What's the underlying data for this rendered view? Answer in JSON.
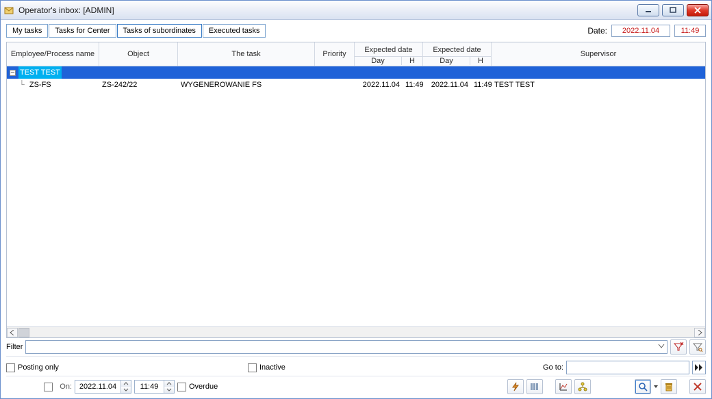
{
  "window": {
    "title": "Operator's inbox: [ADMIN]"
  },
  "tabs": [
    {
      "label": "My tasks"
    },
    {
      "label": "Tasks for Center"
    },
    {
      "label": "Tasks of subordinates",
      "active": true
    },
    {
      "label": "Executed tasks"
    }
  ],
  "date_label": "Date:",
  "date_value": "2022.11.04",
  "time_value": "11:49",
  "columns": {
    "employee": "Employee/Process name",
    "object": "Object",
    "task": "The task",
    "priority": "Priority",
    "expected1": "Expected date",
    "expected2": "Expected date",
    "sub_day": "Day",
    "sub_h": "H",
    "supervisor": "Supervisor"
  },
  "rows": {
    "group": {
      "employee": "TEST TEST"
    },
    "item": {
      "employee": "ZS-FS",
      "object": "ZS-242/22",
      "task": "WYGENEROWANIE FS",
      "priority": "",
      "exp1_day": "2022.11.04",
      "exp1_h": "11:49",
      "exp2_day": "2022.11.04",
      "exp2_h": "11:49",
      "supervisor": "TEST TEST"
    }
  },
  "filter": {
    "label": "Filter",
    "value": ""
  },
  "options": {
    "posting_only": "Posting only",
    "inactive": "Inactive",
    "goto_label": "Go to:"
  },
  "bottom": {
    "on_label": "On:",
    "date": "2022.11.04",
    "time": "11:49",
    "overdue": "Overdue"
  },
  "icons": {
    "app": "inbox-icon",
    "min": "minimize-icon",
    "max": "maximize-icon",
    "close": "close-icon",
    "clear_filter": "clear-filter-icon",
    "filter_builder": "filter-builder-icon",
    "goto": "fast-forward-icon",
    "toolbar1": "bolt-icon",
    "toolbar2": "columns-icon",
    "toolbar3": "chart-icon",
    "toolbar4": "hierarchy-icon",
    "zoom": "magnifier-icon",
    "delete": "trash-icon",
    "close_panel": "close-x-icon"
  }
}
